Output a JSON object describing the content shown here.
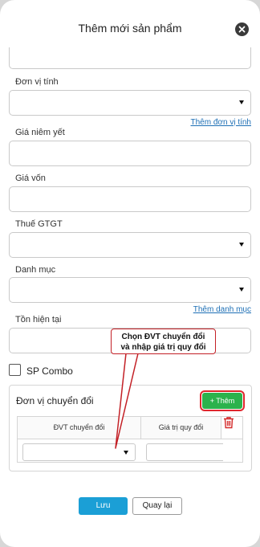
{
  "header": {
    "title": "Thêm mới sản phẩm"
  },
  "form": {
    "unit_label": "Đơn vị tính",
    "add_unit_link": "Thêm đơn vị tính",
    "list_price_label": "Giá niêm yết",
    "cost_price_label": "Giá vốn",
    "vat_label": "Thuế GTGT",
    "category_label": "Danh mục",
    "add_category_link": "Thêm danh mục",
    "stock_label": "Tồn hiện tại",
    "combo_label": "SP Combo"
  },
  "conversion": {
    "title": "Đơn vị chuyển đổi",
    "add_button": "+ Thêm",
    "col_unit": "ĐVT chuyển đổi",
    "col_value": "Giá trị quy đổi"
  },
  "callout": {
    "line1": "Chọn ĐVT chuyển đổi",
    "line2": "và nhập giá trị quy đổi"
  },
  "actions": {
    "save": "Lưu",
    "back": "Quay lại"
  }
}
